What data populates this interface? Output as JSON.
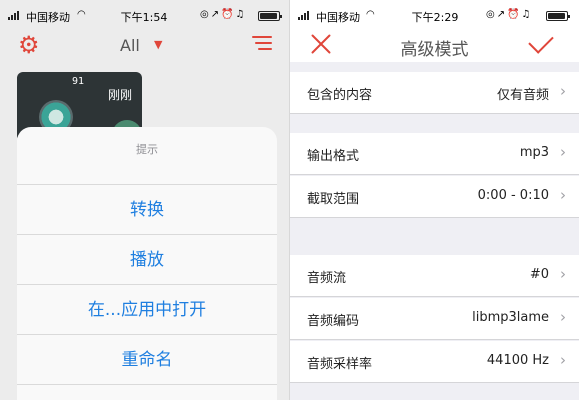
{
  "left_screen": {
    "status": {
      "carrier": "中国移动",
      "time": "下午1:54"
    },
    "nav": {
      "title": "All"
    },
    "thumbnail": {
      "number": "91",
      "when": "刚刚"
    },
    "action_sheet": {
      "header": "提示",
      "actions": [
        "转换",
        "播放",
        "在...应用中打开",
        "重命名"
      ]
    }
  },
  "right_screen": {
    "status": {
      "carrier": "中国移动",
      "time": "下午2:29"
    },
    "nav": {
      "title": "高级模式"
    },
    "rows": [
      {
        "label": "包含的内容",
        "value": "仅有音频"
      },
      {
        "label": "输出格式",
        "value": "mp3"
      },
      {
        "label": "截取范围",
        "value": "0:00 - 0:10"
      },
      {
        "label": "音频流",
        "value": "#0"
      },
      {
        "label": "音频编码",
        "value": "libmp3lame"
      },
      {
        "label": "音频采样率",
        "value": "44100 Hz"
      }
    ]
  },
  "colors": {
    "accent": "#e0463a",
    "link_blue": "#1f7fe0",
    "group_bg": "#efeff4"
  },
  "icons": [
    "signal-icon",
    "wifi-icon",
    "gear-icon",
    "caret-down-icon",
    "filter-icon",
    "close-icon",
    "checkmark-icon",
    "chevron-right-icon"
  ]
}
